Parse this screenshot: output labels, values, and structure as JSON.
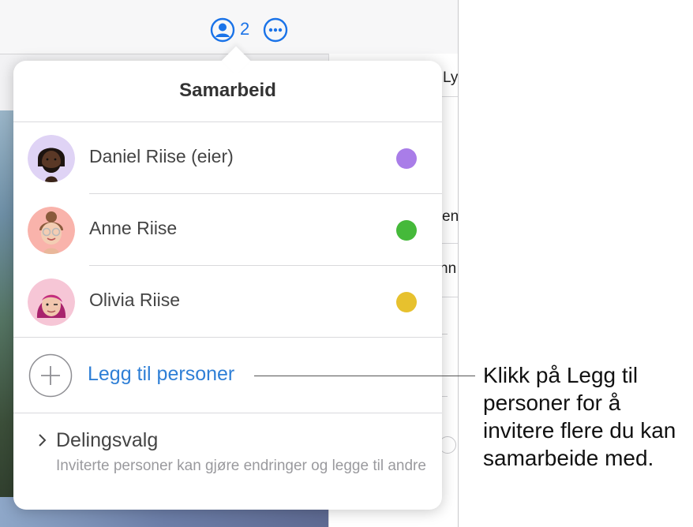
{
  "toolbar": {
    "collaborator_count": "2",
    "collaborate_icon": "person-circle-icon",
    "more_icon": "ellipsis-circle-icon",
    "accent_color": "#1a73e8"
  },
  "side_panel": {
    "fragment_1": "Ly",
    "fragment_2": "en",
    "fragment_3": "nn"
  },
  "popover": {
    "title": "Samarbeid",
    "participants": [
      {
        "name": "Daniel Riise (eier)",
        "color": "#a97de8",
        "avatar": "memoji-bearded-man-avatar"
      },
      {
        "name": "Anne Riise",
        "color": "#45b93a",
        "avatar": "memoji-woman-glasses-avatar"
      },
      {
        "name": "Olivia Riise",
        "color": "#e7c12e",
        "avatar": "memoji-pink-hair-avatar"
      }
    ],
    "add_people": {
      "label": "Legg til personer",
      "icon": "plus-circle-icon",
      "color": "#2f7fd6"
    },
    "sharing": {
      "title": "Delingsvalg",
      "description": "Inviterte personer kan gjøre endringer og legge til andre",
      "icon": "chevron-right-icon"
    }
  },
  "callout": {
    "text": "Klikk på Legg til personer for å invitere flere du kan samarbeide med."
  }
}
